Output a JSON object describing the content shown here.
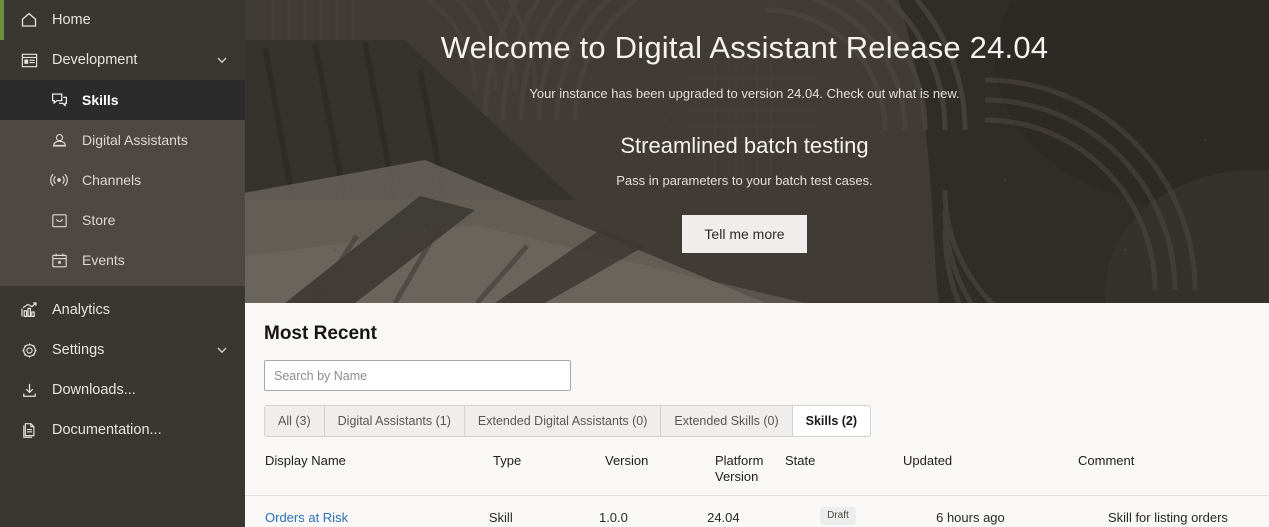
{
  "sidebar": {
    "top_items": [
      {
        "label": "Home",
        "icon": "home-icon",
        "selected_accent": true
      }
    ],
    "group": {
      "label": "Development",
      "icon": "development-icon",
      "chevron": "chevron-down-icon",
      "expanded": true,
      "items": [
        {
          "label": "Skills",
          "icon": "skills-icon",
          "selected": true
        },
        {
          "label": "Digital Assistants",
          "icon": "digital-assistants-icon",
          "selected": false
        },
        {
          "label": "Channels",
          "icon": "channels-icon",
          "selected": false
        },
        {
          "label": "Store",
          "icon": "store-icon",
          "selected": false
        },
        {
          "label": "Events",
          "icon": "events-icon",
          "selected": false
        }
      ]
    },
    "bottom_items": [
      {
        "label": "Analytics",
        "icon": "analytics-icon",
        "chevron": null
      },
      {
        "label": "Settings",
        "icon": "gear-icon",
        "chevron": "chevron-down-icon"
      },
      {
        "label": "Downloads...",
        "icon": "download-icon",
        "chevron": null
      },
      {
        "label": "Documentation...",
        "icon": "documentation-icon",
        "chevron": null
      }
    ],
    "accent_color": "#6f8f3e",
    "background_color": "#3a3630",
    "group_background_color": "#4e4842",
    "selected_background_color": "#2b2b2b"
  },
  "hero": {
    "title": "Welcome to Digital Assistant Release 24.04",
    "subtitle": "Your instance has been upgraded to version 24.04. Check out what is new.",
    "feature_title": "Streamlined batch testing",
    "feature_subtitle": "Pass in parameters to your batch test cases.",
    "button_label": "Tell me more"
  },
  "card": {
    "title": "Most Recent",
    "search": {
      "placeholder": "Search by Name",
      "value": ""
    },
    "tabs": [
      {
        "label": "All (3)",
        "selected": false
      },
      {
        "label": "Digital Assistants (1)",
        "selected": false
      },
      {
        "label": "Extended Digital Assistants (0)",
        "selected": false
      },
      {
        "label": "Extended Skills (0)",
        "selected": false
      },
      {
        "label": "Skills (2)",
        "selected": true
      }
    ],
    "table": {
      "columns": [
        "Display Name",
        "Type",
        "Version",
        "Platform Version",
        "State",
        "Updated",
        "Comment"
      ],
      "rows": [
        {
          "display_name": "Orders at Risk",
          "type": "Skill",
          "version": "1.0.0",
          "platform_version": "24.04",
          "state": "Draft",
          "updated": "6 hours ago",
          "comment": "Skill for listing orders"
        }
      ]
    }
  }
}
